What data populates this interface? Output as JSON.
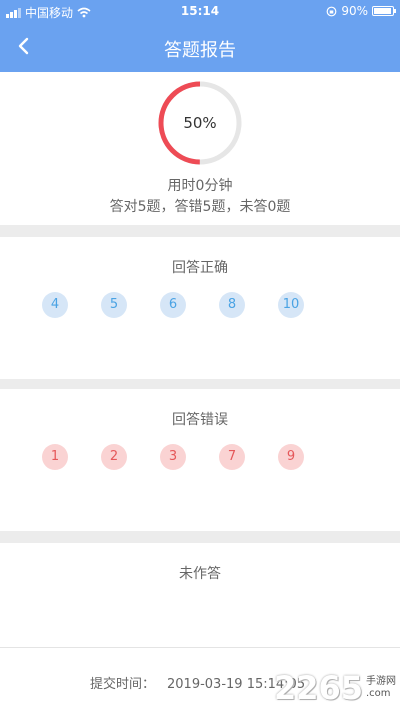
{
  "status_bar": {
    "carrier": "中国移动",
    "time": "15:14",
    "battery": "90%"
  },
  "nav": {
    "title": "答题报告",
    "back_icon": "chevron-left-icon"
  },
  "summary": {
    "percent_label": "50%",
    "progress": 0.5,
    "duration": "用时0分钟",
    "counts": "答对5题，答错5题，未答0题"
  },
  "correct": {
    "title": "回答正确",
    "items": [
      "4",
      "5",
      "6",
      "8",
      "10"
    ]
  },
  "wrong": {
    "title": "回答错误",
    "items": [
      "1",
      "2",
      "3",
      "7",
      "9"
    ]
  },
  "unanswered": {
    "title": "未作答"
  },
  "footer": {
    "submit_label": "提交时间：",
    "submit_time": "2019-03-19 15:14:05"
  },
  "watermark": {
    "number": "2265",
    "line1": "手游网",
    "line2": ".com"
  },
  "colors": {
    "primary": "#6aa2f0",
    "ring_progress": "#ee4b55",
    "ring_track": "#e6e6e6"
  }
}
